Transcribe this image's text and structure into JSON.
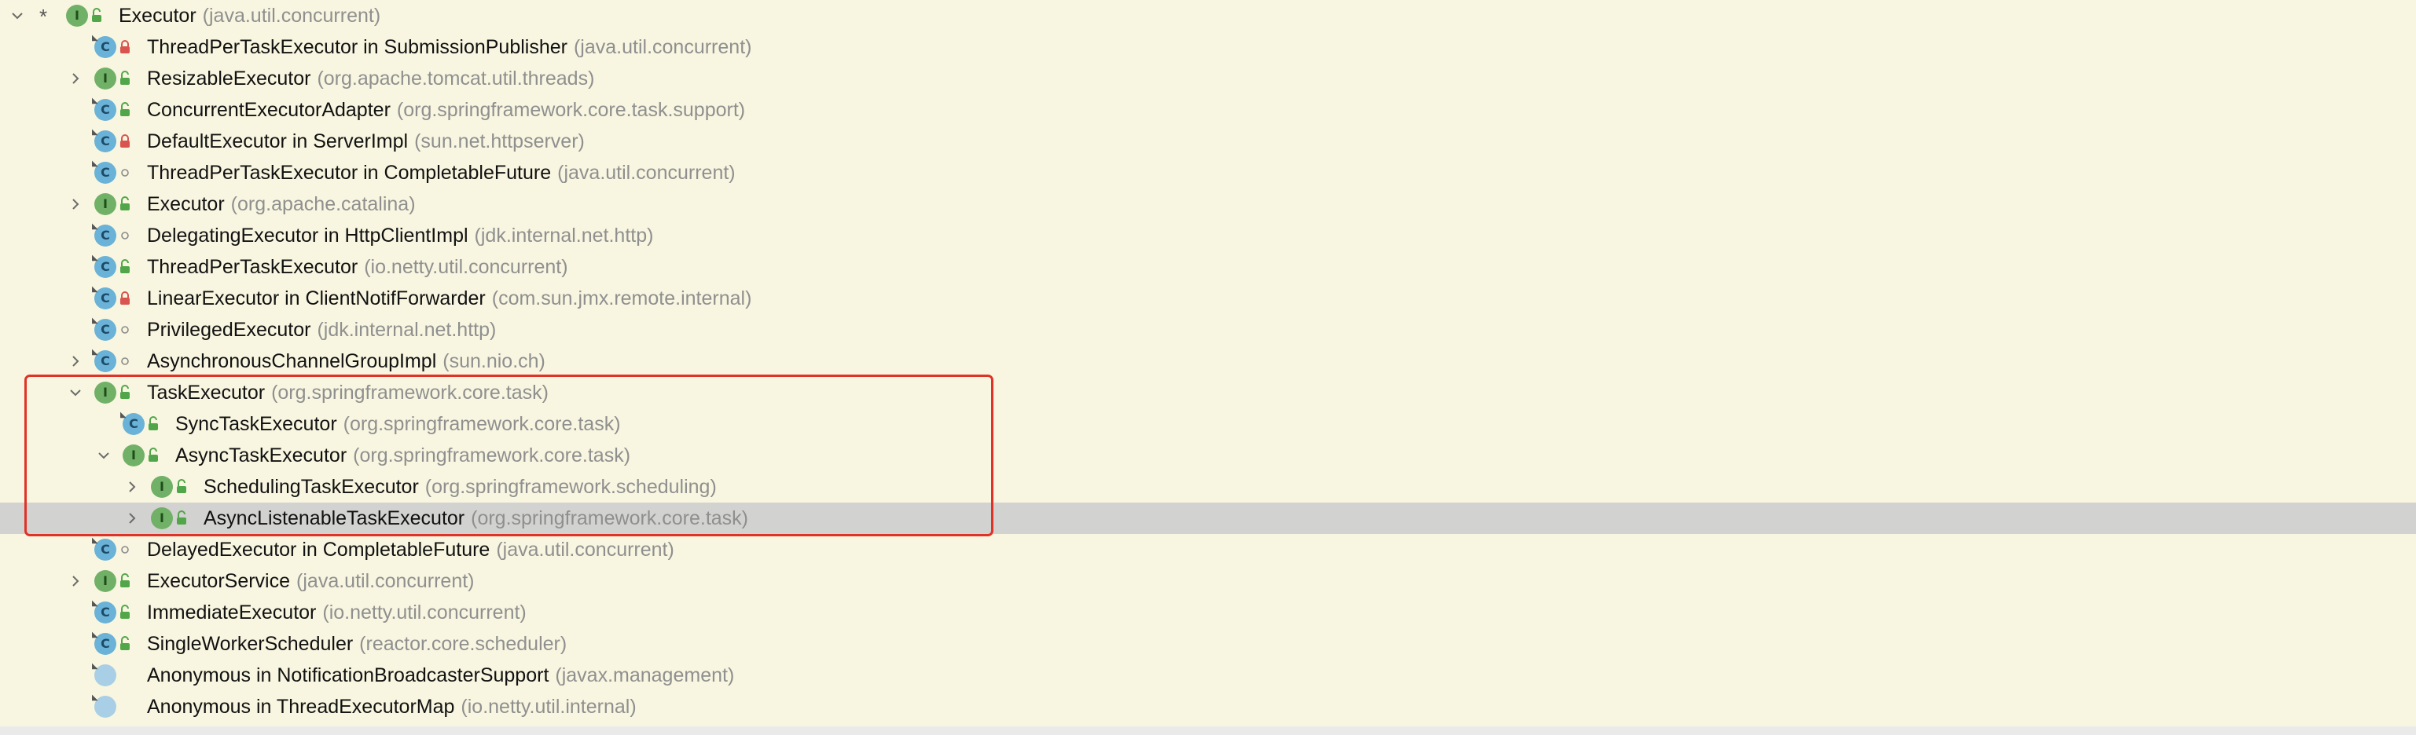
{
  "tree": {
    "rows": [
      {
        "name": "Executor",
        "pkg": "(java.util.concurrent)",
        "depth": 0,
        "kind": "interface",
        "mod": "public",
        "chevron": "down",
        "star": "*"
      },
      {
        "name": "ThreadPerTaskExecutor in SubmissionPublisher",
        "pkg": "(java.util.concurrent)",
        "depth": 1,
        "kind": "class",
        "mod": "private",
        "chevron": "none"
      },
      {
        "name": "ResizableExecutor",
        "pkg": "(org.apache.tomcat.util.threads)",
        "depth": 1,
        "kind": "interface",
        "mod": "public",
        "chevron": "right"
      },
      {
        "name": "ConcurrentExecutorAdapter",
        "pkg": "(org.springframework.core.task.support)",
        "depth": 1,
        "kind": "class",
        "mod": "public",
        "chevron": "none"
      },
      {
        "name": "DefaultExecutor in ServerImpl",
        "pkg": "(sun.net.httpserver)",
        "depth": 1,
        "kind": "class",
        "mod": "private",
        "chevron": "none"
      },
      {
        "name": "ThreadPerTaskExecutor in CompletableFuture",
        "pkg": "(java.util.concurrent)",
        "depth": 1,
        "kind": "class",
        "mod": "package",
        "chevron": "none"
      },
      {
        "name": "Executor",
        "pkg": "(org.apache.catalina)",
        "depth": 1,
        "kind": "interface",
        "mod": "public",
        "chevron": "right"
      },
      {
        "name": "DelegatingExecutor in HttpClientImpl",
        "pkg": "(jdk.internal.net.http)",
        "depth": 1,
        "kind": "class",
        "mod": "package",
        "chevron": "none"
      },
      {
        "name": "ThreadPerTaskExecutor",
        "pkg": "(io.netty.util.concurrent)",
        "depth": 1,
        "kind": "class",
        "mod": "public",
        "chevron": "none"
      },
      {
        "name": "LinearExecutor in ClientNotifForwarder",
        "pkg": "(com.sun.jmx.remote.internal)",
        "depth": 1,
        "kind": "class",
        "mod": "private",
        "chevron": "none"
      },
      {
        "name": "PrivilegedExecutor",
        "pkg": "(jdk.internal.net.http)",
        "depth": 1,
        "kind": "class",
        "mod": "package",
        "chevron": "none"
      },
      {
        "name": "AsynchronousChannelGroupImpl",
        "pkg": "(sun.nio.ch)",
        "depth": 1,
        "kind": "class",
        "mod": "package",
        "chevron": "right"
      },
      {
        "name": "TaskExecutor",
        "pkg": "(org.springframework.core.task)",
        "depth": 1,
        "kind": "interface",
        "mod": "public",
        "chevron": "down"
      },
      {
        "name": "SyncTaskExecutor",
        "pkg": "(org.springframework.core.task)",
        "depth": 2,
        "kind": "class",
        "mod": "public",
        "chevron": "none"
      },
      {
        "name": "AsyncTaskExecutor",
        "pkg": "(org.springframework.core.task)",
        "depth": 2,
        "kind": "interface",
        "mod": "public",
        "chevron": "down"
      },
      {
        "name": "SchedulingTaskExecutor",
        "pkg": "(org.springframework.scheduling)",
        "depth": 3,
        "kind": "interface",
        "mod": "public",
        "chevron": "right"
      },
      {
        "name": "AsyncListenableTaskExecutor",
        "pkg": "(org.springframework.core.task)",
        "depth": 3,
        "kind": "interface",
        "mod": "public",
        "chevron": "right",
        "selected": true
      },
      {
        "name": "DelayedExecutor in CompletableFuture",
        "pkg": "(java.util.concurrent)",
        "depth": 1,
        "kind": "class",
        "mod": "package",
        "chevron": "none"
      },
      {
        "name": "ExecutorService",
        "pkg": "(java.util.concurrent)",
        "depth": 1,
        "kind": "interface",
        "mod": "public",
        "chevron": "right"
      },
      {
        "name": "ImmediateExecutor",
        "pkg": "(io.netty.util.concurrent)",
        "depth": 1,
        "kind": "class",
        "mod": "public",
        "chevron": "none"
      },
      {
        "name": "SingleWorkerScheduler",
        "pkg": "(reactor.core.scheduler)",
        "depth": 1,
        "kind": "class",
        "mod": "public",
        "chevron": "none"
      },
      {
        "name": "Anonymous in NotificationBroadcasterSupport",
        "pkg": "(javax.management)",
        "depth": 1,
        "kind": "anonymous",
        "mod": "none",
        "chevron": "none"
      },
      {
        "name": "Anonymous in ThreadExecutorMap",
        "pkg": "(io.netty.util.internal)",
        "depth": 1,
        "kind": "anonymous",
        "mod": "none",
        "chevron": "none"
      }
    ]
  },
  "colors": {
    "background": "#f8f6e0",
    "selection": "#d2d2d0",
    "highlight_border": "#e03227",
    "package_text": "#8f8f8f",
    "interface_icon": "#71b167",
    "class_icon": "#6ab2d7",
    "lock_private": "#d9534f",
    "lock_public": "#52a64a"
  },
  "icons": {
    "interface": "interface-icon",
    "class": "class-icon",
    "anonymous": "anonymous-class-icon",
    "chevron_down": "chevron-down-icon",
    "chevron_right": "chevron-right-icon"
  }
}
